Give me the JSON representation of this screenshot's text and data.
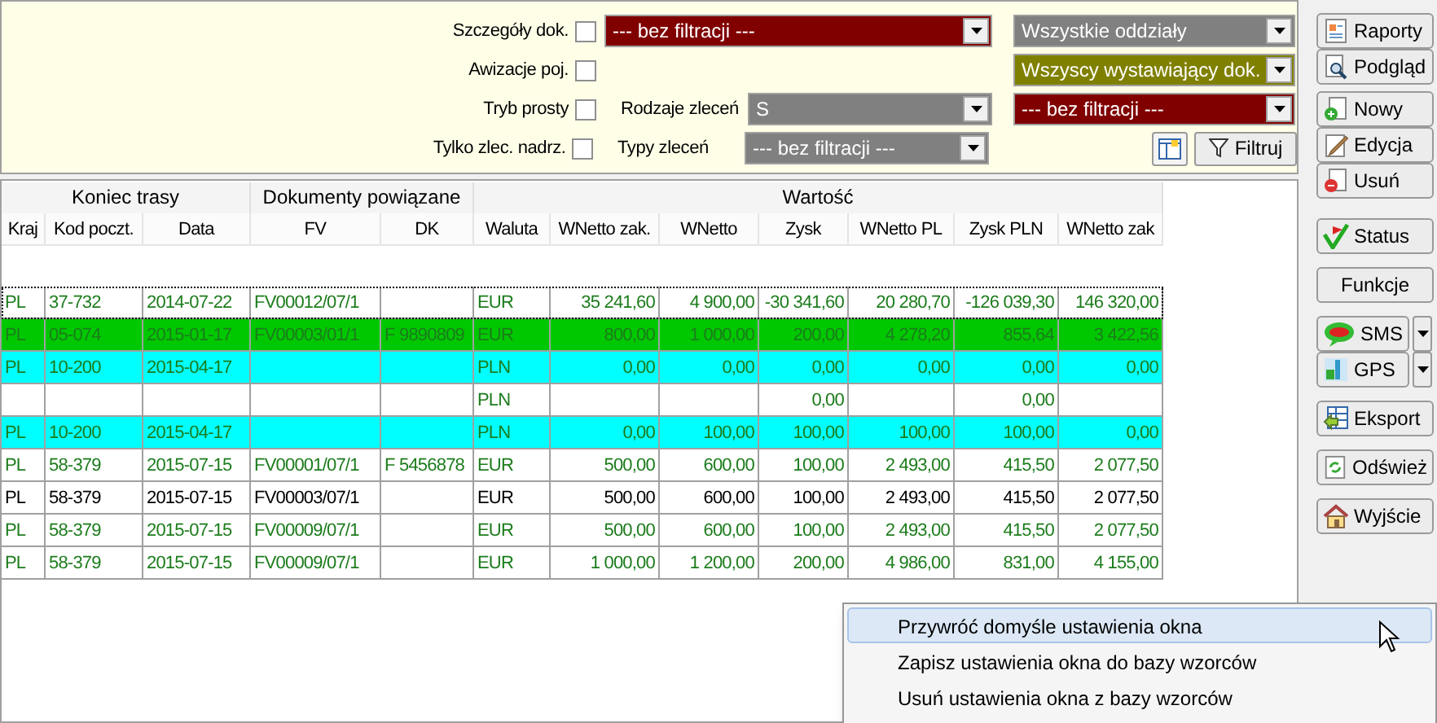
{
  "filters": {
    "rows": [
      {
        "label": "Szczegóły dok.",
        "checked": false,
        "middle": {
          "dropdown": {
            "value": "--- bez filtracji ---",
            "color": "#800000"
          }
        },
        "right": {
          "value": "Wszystkie oddziały",
          "color": "#808080"
        }
      },
      {
        "label": "Awizacje poj.",
        "checked": false,
        "right": {
          "value": "Wszyscy wystawiający dok.",
          "color": "#808000"
        }
      },
      {
        "label": "Tryb prosty",
        "checked": false,
        "middle": {
          "label": "Rodzaje zleceń",
          "dropdown": {
            "value": "S",
            "color": "#808080"
          }
        },
        "right": {
          "value": "--- bez filtracji ---",
          "color": "#800000"
        }
      },
      {
        "label": "Tylko zlec. nadrz.",
        "checked": false,
        "middle": {
          "label": "Typy zleceń",
          "dropdown": {
            "value": "--- bez filtracji ---",
            "color": "#808080"
          }
        }
      }
    ],
    "filter_button": "Filtruj"
  },
  "table": {
    "groups": [
      {
        "label": "Koniec trasy",
        "columns": [
          {
            "label": "Kraj",
            "kind": "text"
          },
          {
            "label": "Kod poczt.",
            "kind": "text"
          },
          {
            "label": "Data",
            "kind": "text"
          }
        ]
      },
      {
        "label": "Dokumenty powiązane",
        "columns": [
          {
            "label": "FV",
            "kind": "text"
          },
          {
            "label": "DK",
            "kind": "text"
          }
        ]
      },
      {
        "label": "Wartość",
        "columns": [
          {
            "label": "Waluta",
            "kind": "text"
          },
          {
            "label": "WNetto zak.",
            "kind": "number"
          },
          {
            "label": "WNetto",
            "kind": "number"
          },
          {
            "label": "Zysk",
            "kind": "number"
          },
          {
            "label": "WNetto PL",
            "kind": "number"
          },
          {
            "label": "Zysk PLN",
            "kind": "number"
          },
          {
            "label": "WNetto zak",
            "kind": "number"
          }
        ]
      }
    ],
    "rows": [
      {
        "color": "#ffffff",
        "kind": "green",
        "focused": true,
        "cells": [
          "PL",
          "37-732",
          "2014-07-22",
          "FV00012/07/1",
          "",
          "EUR",
          "35 241,60",
          "4 900,00",
          "-30 341,60",
          "20 280,70",
          "-126 039,30",
          "146 320,00"
        ]
      },
      {
        "color": "#00c800",
        "kind": "green",
        "focused": false,
        "cells": [
          "PL",
          "05-074",
          "2015-01-17",
          "FV00003/01/1",
          "F 9890809",
          "EUR",
          "800,00",
          "1 000,00",
          "200,00",
          "4 278,20",
          "855,64",
          "3 422,56"
        ]
      },
      {
        "color": "#00ffff",
        "kind": "green",
        "focused": false,
        "cells": [
          "PL",
          "10-200",
          "2015-04-17",
          "",
          "",
          "PLN",
          "0,00",
          "0,00",
          "0,00",
          "0,00",
          "0,00",
          "0,00"
        ]
      },
      {
        "color": "#ffffff",
        "kind": "green",
        "focused": false,
        "cells": [
          "",
          "",
          "",
          "",
          "",
          "PLN",
          "",
          "",
          "0,00",
          "",
          "0,00",
          ""
        ]
      },
      {
        "color": "#00ffff",
        "kind": "green",
        "focused": false,
        "cells": [
          "PL",
          "10-200",
          "2015-04-17",
          "",
          "",
          "PLN",
          "0,00",
          "100,00",
          "100,00",
          "100,00",
          "100,00",
          "0,00"
        ]
      },
      {
        "color": "#ffffff",
        "kind": "green",
        "focused": false,
        "cells": [
          "PL",
          "58-379",
          "2015-07-15",
          "FV00001/07/1",
          "F 5456878",
          "EUR",
          "500,00",
          "600,00",
          "100,00",
          "2 493,00",
          "415,50",
          "2 077,50"
        ]
      },
      {
        "color": "#ffffff",
        "kind": "black",
        "focused": false,
        "cells": [
          "PL",
          "58-379",
          "2015-07-15",
          "FV00003/07/1",
          "",
          "EUR",
          "500,00",
          "600,00",
          "100,00",
          "2 493,00",
          "415,50",
          "2 077,50"
        ]
      },
      {
        "color": "#ffffff",
        "kind": "green",
        "focused": false,
        "cells": [
          "PL",
          "58-379",
          "2015-07-15",
          "FV00009/07/1",
          "",
          "EUR",
          "500,00",
          "600,00",
          "100,00",
          "2 493,00",
          "415,50",
          "2 077,50"
        ]
      },
      {
        "color": "#ffffff",
        "kind": "green",
        "focused": false,
        "cells": [
          "PL",
          "58-379",
          "2015-07-15",
          "FV00009/07/1",
          "",
          "EUR",
          "1 000,00",
          "1 200,00",
          "200,00",
          "4 986,00",
          "831,00",
          "4 155,00"
        ]
      }
    ]
  },
  "buttons": [
    {
      "label": "Raporty",
      "kind": "report",
      "split": false
    },
    {
      "label": "Podgląd",
      "kind": "preview",
      "split": false
    },
    {
      "label": "Nowy",
      "kind": "new",
      "split": false
    },
    {
      "label": "Edycja",
      "kind": "edit",
      "split": false
    },
    {
      "label": "Usuń",
      "kind": "delete",
      "split": false
    },
    {
      "label": "Status",
      "kind": "status",
      "split": false
    },
    {
      "label": "Funkcje",
      "kind": "plain",
      "split": false
    },
    {
      "label": "SMS",
      "kind": "sms",
      "split": true
    },
    {
      "label": "GPS",
      "kind": "gps",
      "split": true
    },
    {
      "label": "Eksport",
      "kind": "export",
      "split": false
    },
    {
      "label": "Odśwież",
      "kind": "refresh",
      "split": false
    },
    {
      "label": "Wyjście",
      "kind": "home",
      "split": false
    }
  ],
  "context_menu": [
    {
      "label": "Przywróć domyśle ustawienia okna",
      "selected": true
    },
    {
      "label": "Zapisz ustawienia okna do bazy wzorców",
      "selected": false
    },
    {
      "label": "Usuń ustawienia okna z bazy wzorców",
      "selected": false
    }
  ]
}
